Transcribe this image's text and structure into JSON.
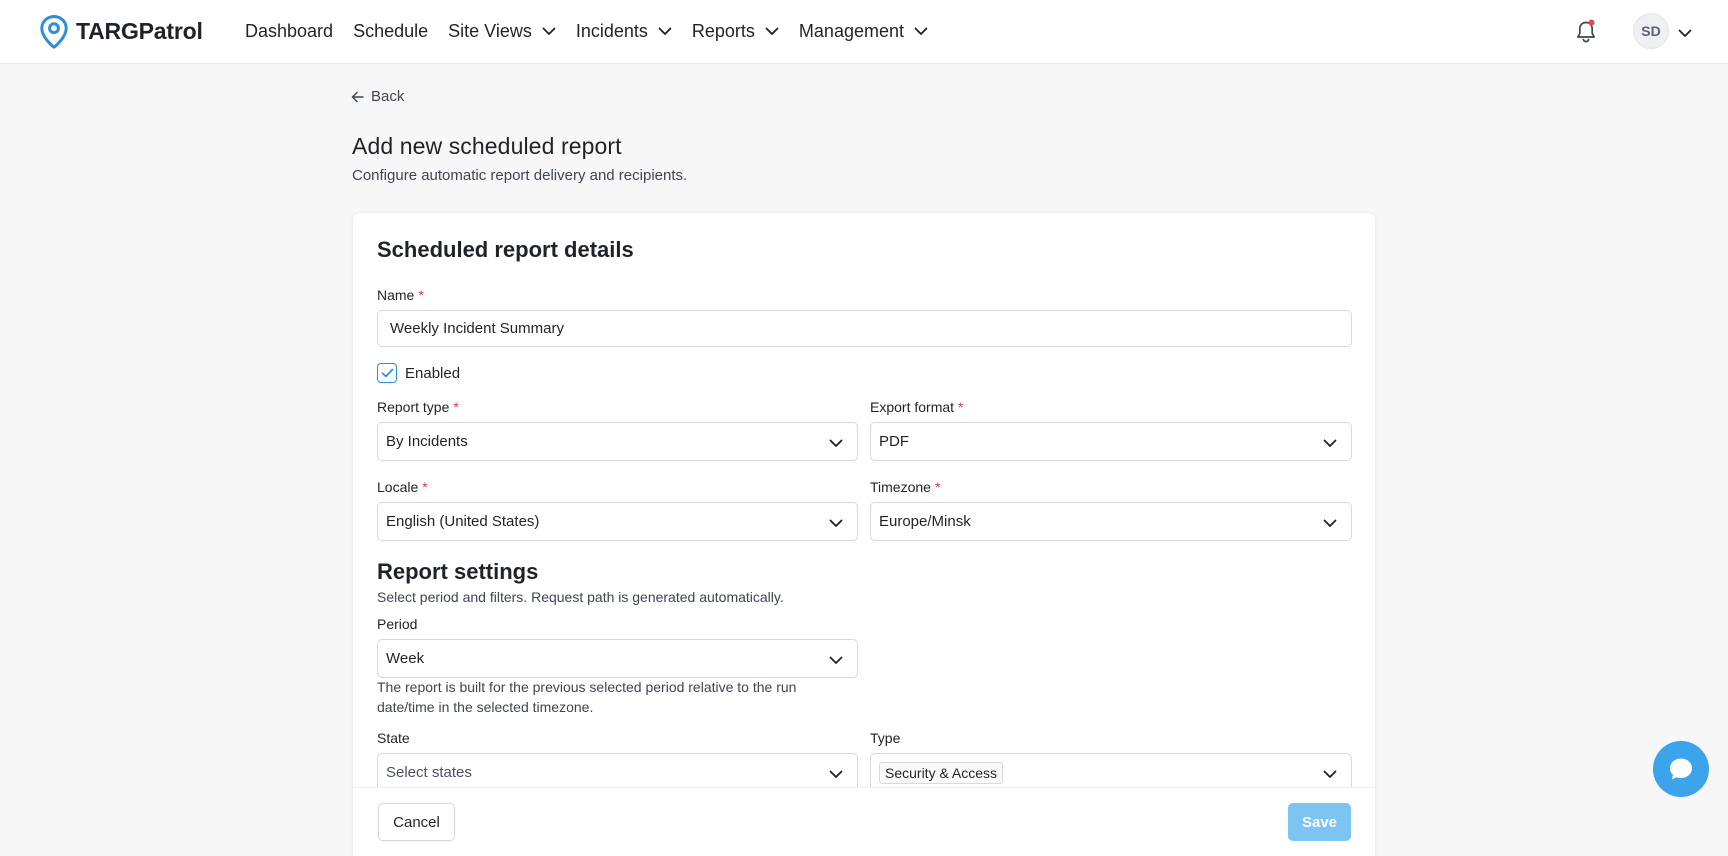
{
  "app": {
    "name": "TARGPatrol",
    "brand_color": "#2d8fd6"
  },
  "nav": {
    "items": [
      {
        "label": "Dashboard",
        "has_dropdown": false
      },
      {
        "label": "Schedule",
        "has_dropdown": false
      },
      {
        "label": "Site Views",
        "has_dropdown": true
      },
      {
        "label": "Incidents",
        "has_dropdown": true
      },
      {
        "label": "Reports",
        "has_dropdown": true
      },
      {
        "label": "Management",
        "has_dropdown": true
      }
    ]
  },
  "user": {
    "initials": "SD",
    "notification_dot_color": "#e5484d"
  },
  "page": {
    "back_label": "Back",
    "title": "Add new scheduled report",
    "subtitle": "Configure automatic report delivery and recipients."
  },
  "details": {
    "section_title": "Scheduled report details",
    "name_label": "Name",
    "name_value": "Weekly Incident Summary",
    "enabled_label": "Enabled",
    "enabled_checked": true,
    "report_type_label": "Report type",
    "report_type_value": "By Incidents",
    "export_format_label": "Export format",
    "export_format_value": "PDF",
    "locale_label": "Locale",
    "locale_value": "English (United States)",
    "timezone_label": "Timezone",
    "timezone_value": "Europe/Minsk",
    "required_mark": "*"
  },
  "settings": {
    "section_title": "Report settings",
    "subtitle": "Select period and filters. Request path is generated automatically.",
    "period_label": "Period",
    "period_value": "Week",
    "period_helper_line1": "The report is built for the previous selected period relative to the run",
    "period_helper_line2": "date/time in the selected timezone.",
    "state_label": "State",
    "state_placeholder": "Select states",
    "type_label": "Type",
    "type_selected_chip": "Security & Access"
  },
  "footer": {
    "cancel_label": "Cancel",
    "save_label": "Save",
    "save_color": "#7cc4f2"
  },
  "icons": [
    "location-pin-logo-icon",
    "chevron-down-icon",
    "bell-icon",
    "arrow-left-icon",
    "check-icon",
    "chat-bubble-icon"
  ]
}
